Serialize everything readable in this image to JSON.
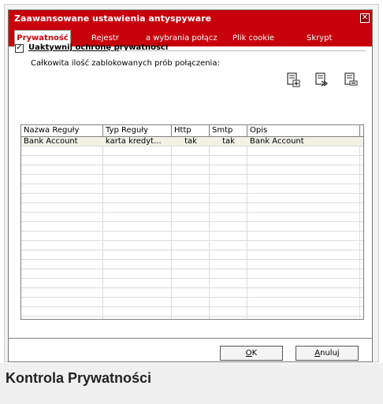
{
  "window": {
    "title": "Zaawansowane ustawienia antyspyware",
    "close_glyph": "✕"
  },
  "tabs": [
    {
      "label": "Prywatność",
      "active": true
    },
    {
      "label": "Rejestr",
      "active": false
    },
    {
      "label": "a wybrania połącz",
      "active": false
    },
    {
      "label": "Plik cookie",
      "active": false
    },
    {
      "label": "Skrypt",
      "active": false
    }
  ],
  "privacy": {
    "enable_checkbox_label": "Uaktywnij ochronę prywatności",
    "enable_checkbox_checked": true,
    "blocked_attempts_label": "Całkowita ilość zablokowanych prób połączenia:"
  },
  "toolbar_icons": [
    {
      "name": "add-rule-icon"
    },
    {
      "name": "edit-rule-icon"
    },
    {
      "name": "delete-rule-icon"
    }
  ],
  "table": {
    "columns": [
      "Nazwa Reguły",
      "Typ Reguły",
      "Http",
      "Smtp",
      "Opis"
    ],
    "rows": [
      [
        "Bank Account",
        "karta kredyt...",
        "tak",
        "tak",
        "Bank Account"
      ]
    ]
  },
  "buttons": {
    "ok": {
      "mnemonic": "O",
      "rest": "K"
    },
    "cancel": {
      "mnemonic": "A",
      "rest": "nuluj"
    }
  },
  "caption": "Kontrola Prywatności",
  "colors": {
    "accent": "#c8000c",
    "selected_row": "#f1f1e6"
  }
}
